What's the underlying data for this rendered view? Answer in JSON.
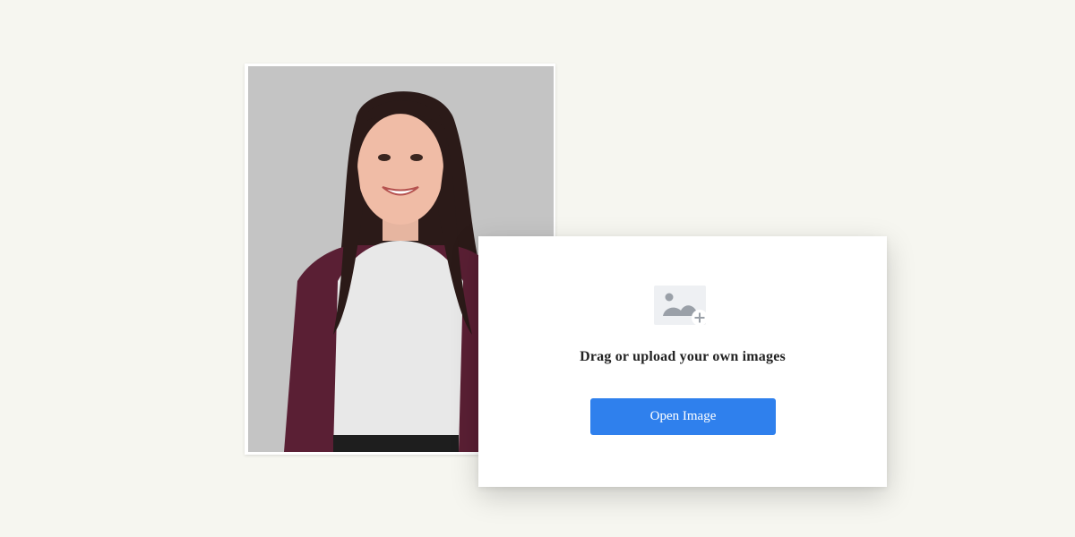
{
  "upload": {
    "label": "Drag or upload your own images",
    "button_label": "Open Image",
    "icon": "add-image-icon"
  },
  "photo": {
    "icon": "portrait-photo"
  },
  "colors": {
    "background": "#f6f6f0",
    "accent": "#2f80ed",
    "icon_gray": "#9aa0a8"
  }
}
